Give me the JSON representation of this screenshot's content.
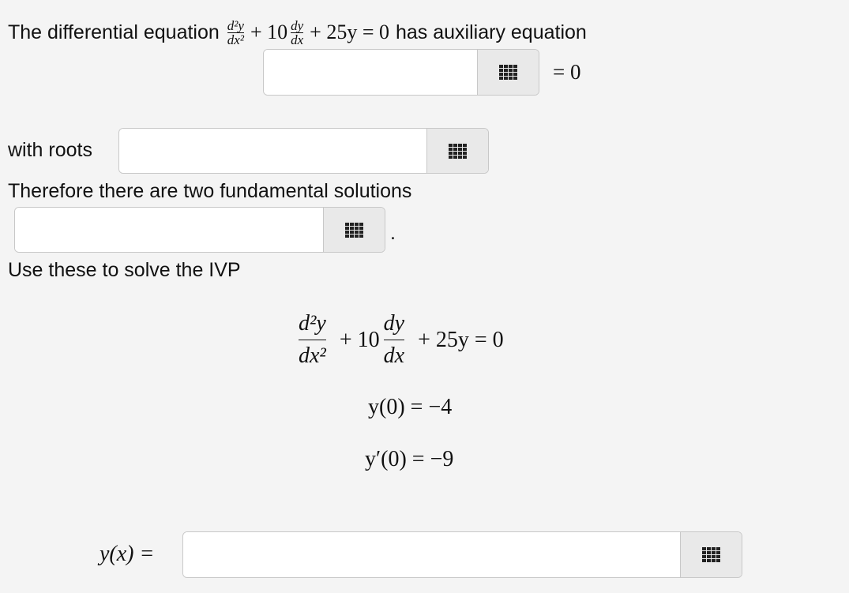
{
  "intro": {
    "prefix": "The differential equation",
    "suffix": "has auxiliary equation",
    "equals_zero": "= 0"
  },
  "ode": {
    "d2y": "d²y",
    "dx2": "dx²",
    "dy": "dy",
    "dx": "dx",
    "plus_10": "+ 10",
    "plus_25y_equals_0": "+ 25y = 0"
  },
  "roots": {
    "label": "with roots"
  },
  "fundamental": {
    "text": "Therefore there are two fundamental solutions",
    "period": "."
  },
  "ivp": {
    "label": "Use these to solve the IVP",
    "ic1": "y(0) = −4",
    "ic2": "y′(0) = −9"
  },
  "answer": {
    "label": "y(x) ="
  },
  "icons": {
    "palette": "grid-icon"
  }
}
